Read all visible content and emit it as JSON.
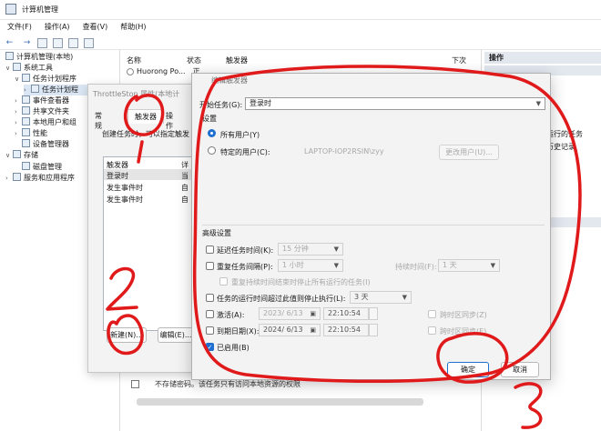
{
  "window": {
    "title": "计算机管理"
  },
  "menu": [
    "文件(F)",
    "操作(A)",
    "查看(V)",
    "帮助(H)"
  ],
  "tree": {
    "root": "计算机管理(本地)",
    "system_tools": "系统工具",
    "task_scheduler": "任务计划程序",
    "task_library": "任务计划程",
    "event_viewer": "事件查看器",
    "shared_folders": "共享文件夹",
    "local_users": "本地用户和组",
    "performance": "性能",
    "device_manager": "设备管理器",
    "storage": "存储",
    "disk_management": "磁盘管理",
    "services_apps": "服务和应用程序"
  },
  "center": {
    "columns": [
      "名称",
      "状态",
      "触发器",
      "下次"
    ],
    "rows": [
      {
        "name": "Huorong Po...",
        "status": "正"
      }
    ],
    "bottom_checkbox_text": "不存储密码。该任务只有访问本地资源的权限"
  },
  "actions": {
    "header": "操作",
    "items": [
      "运行的任务",
      "历史记录"
    ]
  },
  "props_dialog": {
    "title": "ThrottleStop 属性(本地计",
    "tabs": [
      "常规",
      "触发器",
      "操作"
    ],
    "description": "创建任务时，可以指定触发",
    "list_headers": [
      "触发器",
      "详"
    ],
    "triggers": [
      {
        "name": "登录时",
        "detail": "当"
      },
      {
        "name": "发生事件时",
        "detail": "自"
      },
      {
        "name": "发生事件时",
        "detail": "自"
      }
    ],
    "new_button": "新建(N)...",
    "edit_button": "编辑(E)..."
  },
  "edit_dialog": {
    "title": "编辑触发器",
    "begin_task_label": "开始任务(G):",
    "begin_task_value": "登录时",
    "settings_label": "设置",
    "any_user": "所有用户(Y)",
    "specific_user": "特定的用户(C):",
    "user_value": "LAPTOP-IOP2RSIN\\zyy",
    "change_user_button": "更改用户(U)...",
    "advanced_label": "高级设置",
    "delay_label": "延迟任务时间(K):",
    "delay_value": "15 分钟",
    "repeat_label": "重复任务间隔(P):",
    "repeat_value": "1 小时",
    "duration_label": "持续时间(F):",
    "duration_value": "1 天",
    "stop_repeat_label": "重复持续时间结束时停止所有运行的任务(I)",
    "stop_after_label": "任务的运行时间超过此值则停止执行(L):",
    "stop_after_value": "3 天",
    "activate_label": "激活(A):",
    "activate_date": "2023/ 6/13",
    "activate_time": "22:10:54",
    "sync_tz_1": "跨时区同步(Z)",
    "expire_label": "到期日期(X):",
    "expire_date": "2024/ 6/13",
    "expire_time": "22:10:54",
    "sync_tz_2": "跨时区同步(E)",
    "enabled_label": "已启用(B)",
    "ok_button": "确定",
    "cancel_button": "取消"
  },
  "annotations": {
    "num1": "1",
    "num2": "2",
    "num3": "3"
  },
  "colors": {
    "ink": "#e0191b",
    "accent": "#1e6fd0",
    "dialog_bg": "#f3f3f3"
  }
}
